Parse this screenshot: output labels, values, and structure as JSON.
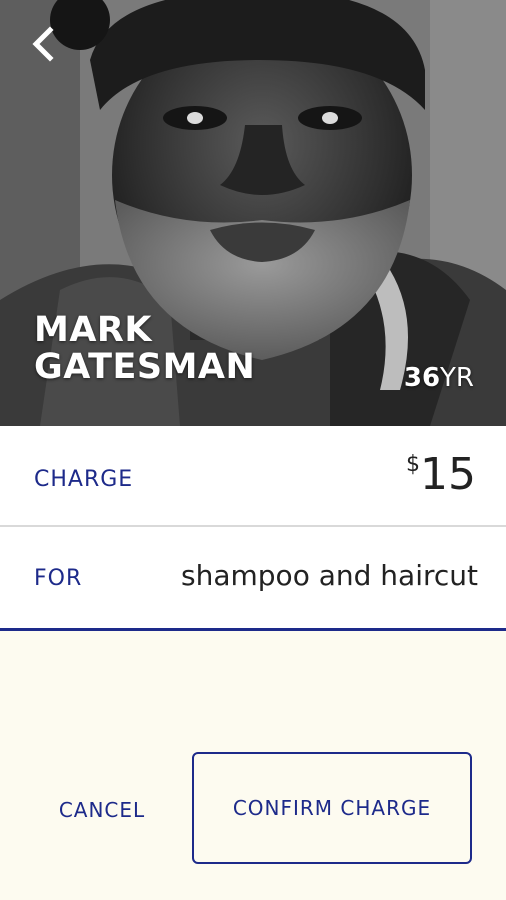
{
  "profile": {
    "first_name": "MARK",
    "last_name": "GATESMAN",
    "age_number": "36",
    "age_unit": "YR"
  },
  "charge": {
    "label": "CHARGE",
    "currency": "$",
    "amount": "15"
  },
  "service": {
    "label": "FOR",
    "description": "shampoo and haircut"
  },
  "actions": {
    "cancel_label": "CANCEL",
    "confirm_label": "CONFIRM CHARGE"
  },
  "icons": {
    "back": "chevron-left-icon"
  },
  "colors": {
    "accent": "#1d2a8a",
    "background": "#fdfbf0"
  }
}
